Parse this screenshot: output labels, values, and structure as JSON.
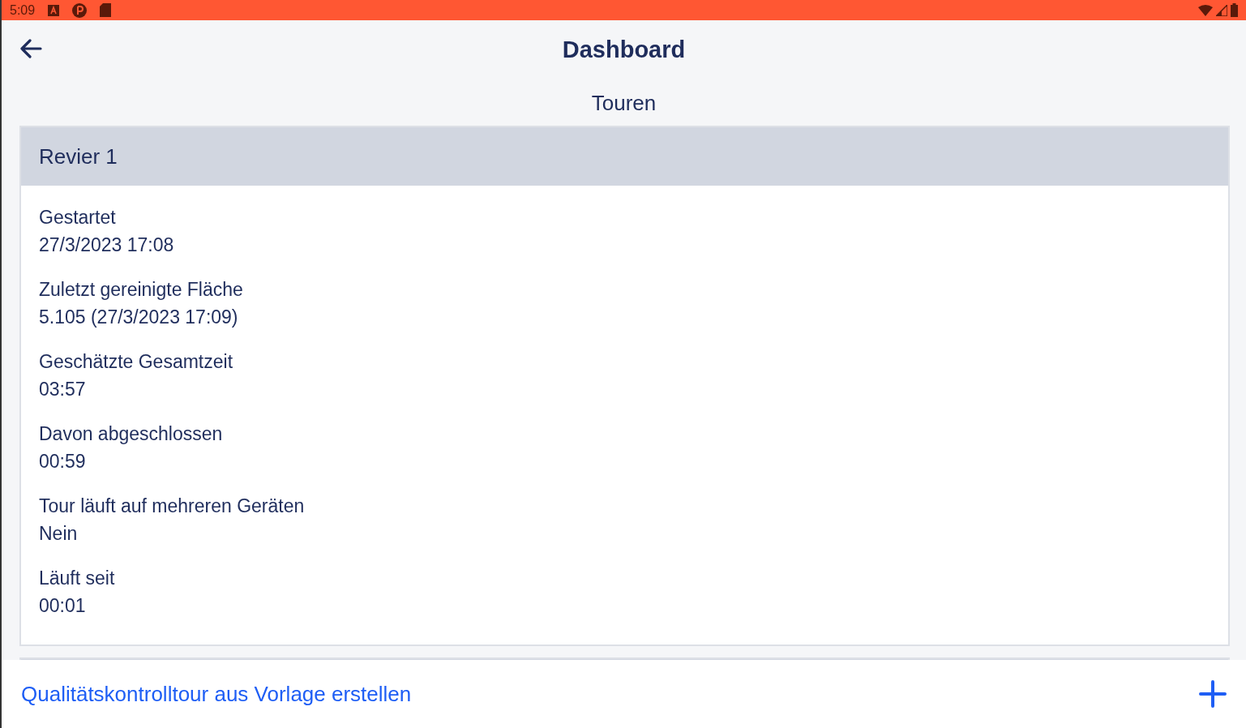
{
  "status_bar": {
    "time": "5:09"
  },
  "header": {
    "title": "Dashboard"
  },
  "section_title": "Touren",
  "tours": [
    {
      "title": "Revier 1",
      "fields": [
        {
          "label": "Gestartet",
          "value": "27/3/2023 17:08"
        },
        {
          "label": "Zuletzt gereinigte Fläche",
          "value": "5.105 (27/3/2023 17:09)"
        },
        {
          "label": "Geschätzte Gesamtzeit",
          "value": "03:57"
        },
        {
          "label": "Davon abgeschlossen",
          "value": "00:59"
        },
        {
          "label": "Tour läuft auf mehreren Geräten",
          "value": "Nein"
        },
        {
          "label": "Läuft seit",
          "value": "00:01"
        }
      ]
    }
  ],
  "bottom_bar": {
    "action": "Qualitätskontrolltour aus Vorlage erstellen"
  }
}
